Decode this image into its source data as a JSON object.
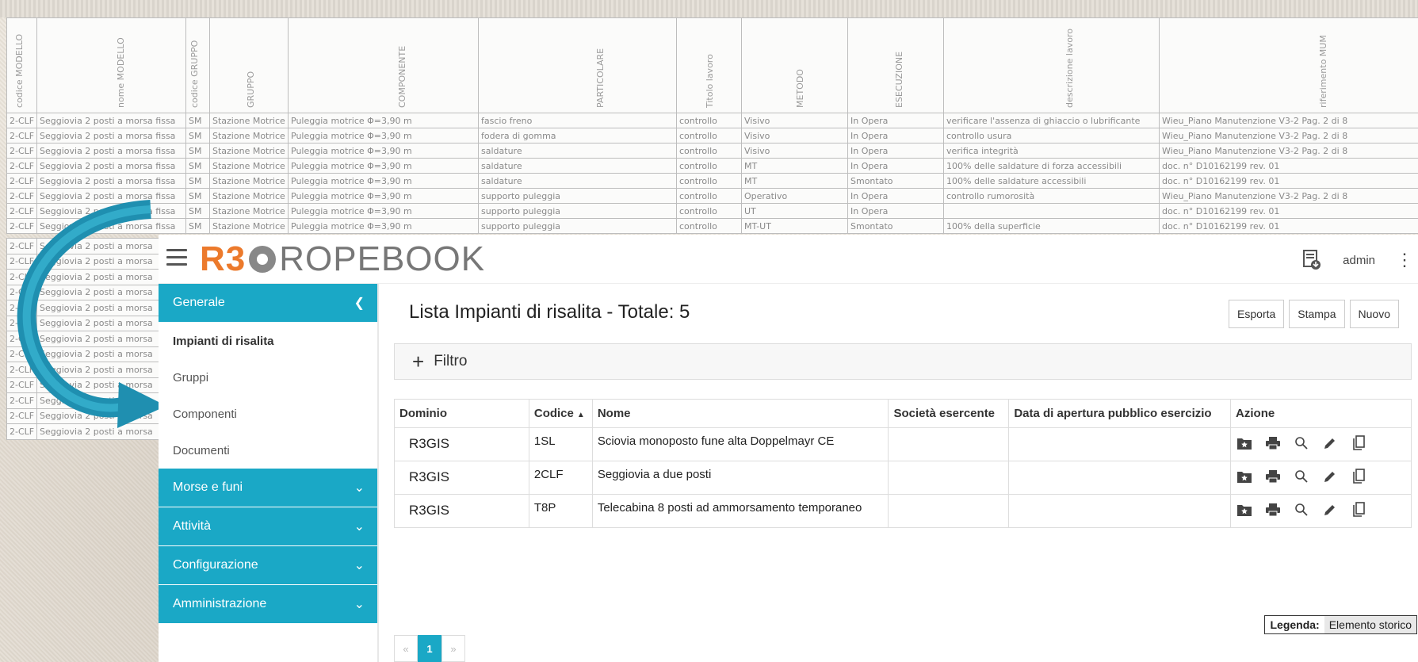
{
  "background_sheet": {
    "headers": [
      "codice MODELLO",
      "nome MODELLO",
      "codice GRUPPO",
      "GRUPPO",
      "COMPONENTE",
      "PARTICOLARE",
      "Titolo lavoro",
      "METODO",
      "ESECUZIONE",
      "descrizione lavoro",
      "riferimento MUM"
    ],
    "rows": [
      [
        "2-CLF",
        "Seggiovia 2 posti a morsa fissa",
        "SM",
        "Stazione Motrice",
        "Puleggia motrice Φ=3,90 m",
        "fascio freno",
        "controllo",
        "Visivo",
        "In Opera",
        "verificare l'assenza di ghiaccio o lubrificante",
        "Wieu_Piano Manutenzione V3-2 Pag. 2 di 8"
      ],
      [
        "2-CLF",
        "Seggiovia 2 posti a morsa fissa",
        "SM",
        "Stazione Motrice",
        "Puleggia motrice Φ=3,90 m",
        "fodera di gomma",
        "controllo",
        "Visivo",
        "In Opera",
        "controllo usura",
        "Wieu_Piano Manutenzione V3-2 Pag. 2 di 8"
      ],
      [
        "2-CLF",
        "Seggiovia 2 posti a morsa fissa",
        "SM",
        "Stazione Motrice",
        "Puleggia motrice Φ=3,90 m",
        "saldature",
        "controllo",
        "Visivo",
        "In Opera",
        "verifica integrità",
        "Wieu_Piano Manutenzione V3-2 Pag. 2 di 8"
      ],
      [
        "2-CLF",
        "Seggiovia 2 posti a morsa fissa",
        "SM",
        "Stazione Motrice",
        "Puleggia motrice Φ=3,90 m",
        "saldature",
        "controllo",
        "MT",
        "In Opera",
        "100% delle saldature di forza accessibili",
        "doc. n° D10162199 rev. 01"
      ],
      [
        "2-CLF",
        "Seggiovia 2 posti a morsa fissa",
        "SM",
        "Stazione Motrice",
        "Puleggia motrice Φ=3,90 m",
        "saldature",
        "controllo",
        "MT",
        "Smontato",
        "100% delle saldature accessibili",
        "doc. n° D10162199 rev. 01"
      ],
      [
        "2-CLF",
        "Seggiovia 2 posti a morsa fissa",
        "SM",
        "Stazione Motrice",
        "Puleggia motrice Φ=3,90 m",
        "supporto puleggia",
        "controllo",
        "Operativo",
        "In Opera",
        "controllo rumorosità",
        "Wieu_Piano Manutenzione V3-2 Pag. 2 di 8"
      ],
      [
        "2-CLF",
        "Seggiovia 2 posti a morsa fissa",
        "SM",
        "Stazione Motrice",
        "Puleggia motrice Φ=3,90 m",
        "supporto puleggia",
        "controllo",
        "UT",
        "In Opera",
        "",
        "doc. n° D10162199 rev. 01"
      ],
      [
        "2-CLF",
        "Seggiovia 2 posti a morsa fissa",
        "SM",
        "Stazione Motrice",
        "Puleggia motrice Φ=3,90 m",
        "supporto puleggia",
        "controllo",
        "MT-UT",
        "Smontato",
        "100% della superficie",
        "doc. n° D10162199 rev. 01"
      ]
    ],
    "left_row_code": "2-CLF",
    "left_row_name": "Seggiovia 2 posti a morsa"
  },
  "app": {
    "logo": {
      "r3": "R3",
      "rest": "ROPEBOOK"
    },
    "user": "admin",
    "kebab": "⋮"
  },
  "sidebar": {
    "generale": "Generale",
    "sub_items": [
      "Impianti di risalita",
      "Gruppi",
      "Componenti",
      "Documenti"
    ],
    "sections": [
      "Morse e funi",
      "Attività",
      "Configurazione",
      "Amministrazione"
    ]
  },
  "main": {
    "title": "Lista Impianti di risalita - Totale: 5",
    "buttons": {
      "export": "Esporta",
      "print": "Stampa",
      "new": "Nuovo"
    },
    "filter": "Filtro",
    "table": {
      "headers": [
        "Dominio",
        "Codice",
        "Nome",
        "Società esercente",
        "Data di apertura pubblico esercizio",
        "Azione"
      ],
      "sort_indicator": "▲",
      "rows": [
        {
          "dominio": "R3GIS",
          "codice": "1SL",
          "nome": "Sciovia monoposto fune alta Doppelmayr CE",
          "societa": "",
          "data": ""
        },
        {
          "dominio": "R3GIS",
          "codice": "2CLF",
          "nome": "Seggiovia a due posti",
          "societa": "",
          "data": ""
        },
        {
          "dominio": "R3GIS",
          "codice": "T8P",
          "nome": "Telecabina 8 posti ad ammorsamento temporaneo",
          "societa": "",
          "data": ""
        }
      ]
    },
    "pager": {
      "prev": "«",
      "current": "1",
      "next": "»"
    },
    "legend": {
      "label": "Legenda:",
      "value": "Elemento storico"
    }
  },
  "colors": {
    "accent": "#1aa8c6",
    "logo_orange": "#ec7a2c",
    "arrow": "#1f8fb0"
  },
  "icons": [
    "folder-star-icon",
    "print-icon",
    "search-icon",
    "edit-icon",
    "copy-icon",
    "download-doc-icon",
    "hamburger-icon",
    "chevron-left-icon",
    "chevron-down-icon"
  ]
}
